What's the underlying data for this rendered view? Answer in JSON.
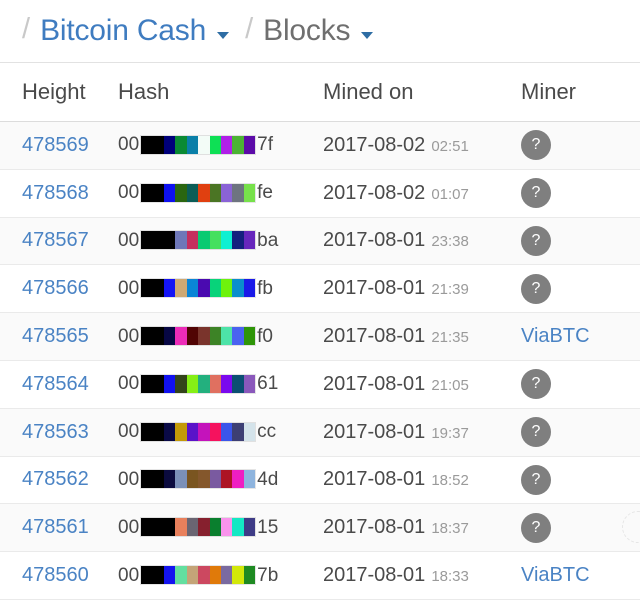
{
  "breadcrumb": {
    "separator": "/",
    "items": [
      {
        "label": "Bitcoin Cash",
        "style": "link",
        "caret": true
      },
      {
        "label": "Blocks",
        "style": "plain",
        "caret": true
      }
    ]
  },
  "table": {
    "columns": [
      "Height",
      "Hash",
      "Mined on",
      "Miner"
    ],
    "hash_prefix": "00",
    "rows": [
      {
        "height": "478569",
        "hash_prefix": "00",
        "hash_suffix": "7f",
        "hash_colors": [
          "#000000",
          "#000000",
          "#00007a",
          "#0a8a33",
          "#0a7fa8",
          "#f3fcf7",
          "#0ee055",
          "#b020e8",
          "#4cb334",
          "#5c0ba8"
        ],
        "mined_date": "2017-08-02",
        "mined_time": "02:51",
        "miner": "?",
        "miner_type": "unknown"
      },
      {
        "height": "478568",
        "hash_prefix": "00",
        "hash_suffix": "fe",
        "hash_colors": [
          "#000000",
          "#000000",
          "#0e11ef",
          "#2a6610",
          "#0b5d57",
          "#e04010",
          "#4b7524",
          "#8a63d6",
          "#6e7480",
          "#77e14b"
        ],
        "mined_date": "2017-08-02",
        "mined_time": "01:07",
        "miner": "?",
        "miner_type": "unknown"
      },
      {
        "height": "478567",
        "hash_prefix": "00",
        "hash_suffix": "ba",
        "hash_colors": [
          "#000000",
          "#000000",
          "#000000",
          "#6e77b8",
          "#c42f5e",
          "#09ca72",
          "#44e05f",
          "#0ef0d2",
          "#14217e",
          "#6727bc"
        ],
        "mined_date": "2017-08-01",
        "mined_time": "23:38",
        "miner": "?",
        "miner_type": "unknown"
      },
      {
        "height": "478566",
        "hash_prefix": "00",
        "hash_suffix": "fb",
        "hash_colors": [
          "#000000",
          "#000000",
          "#1414f5",
          "#cfa974",
          "#0a85d6",
          "#4a0ab0",
          "#08d37a",
          "#6ef20c",
          "#0a8fcc",
          "#1a1ae8"
        ],
        "mined_date": "2017-08-01",
        "mined_time": "21:39",
        "miner": "?",
        "miner_type": "unknown"
      },
      {
        "height": "478565",
        "hash_prefix": "00",
        "hash_suffix": "f0",
        "hash_colors": [
          "#000000",
          "#000000",
          "#070743",
          "#ec2cb8",
          "#510404",
          "#7a342c",
          "#3d8326",
          "#4de3a8",
          "#4a62f0",
          "#2e9508"
        ],
        "mined_date": "2017-08-01",
        "mined_time": "21:35",
        "miner": "ViaBTC",
        "miner_type": "named"
      },
      {
        "height": "478564",
        "hash_prefix": "00",
        "hash_suffix": "61",
        "hash_colors": [
          "#000000",
          "#000000",
          "#1111ef",
          "#33441a",
          "#86ef16",
          "#23b07e",
          "#e07060",
          "#7a09ee",
          "#0b4f72",
          "#8a58bb"
        ],
        "mined_date": "2017-08-01",
        "mined_time": "21:05",
        "miner": "?",
        "miner_type": "unknown"
      },
      {
        "height": "478563",
        "hash_prefix": "00",
        "hash_suffix": "cc",
        "hash_colors": [
          "#000000",
          "#000000",
          "#0a0a46",
          "#c49a08",
          "#5a13c9",
          "#c413bb",
          "#f5125e",
          "#3a55ea",
          "#3d3f74",
          "#d4e3ea"
        ],
        "mined_date": "2017-08-01",
        "mined_time": "19:37",
        "miner": "?",
        "miner_type": "unknown"
      },
      {
        "height": "478562",
        "hash_prefix": "00",
        "hash_suffix": "4d",
        "hash_colors": [
          "#000000",
          "#000000",
          "#0b0b3e",
          "#7b90b8",
          "#7a5520",
          "#84572c",
          "#7a5aa0",
          "#ad1424",
          "#ef1ec2",
          "#8eb4de"
        ],
        "mined_date": "2017-08-01",
        "mined_time": "18:52",
        "miner": "?",
        "miner_type": "unknown"
      },
      {
        "height": "478561",
        "hash_prefix": "00",
        "hash_suffix": "15",
        "hash_colors": [
          "#000000",
          "#000000",
          "#000000",
          "#e8805c",
          "#6a6572",
          "#86202e",
          "#0a7f2e",
          "#f994ec",
          "#14e8c4",
          "#3e3b86"
        ],
        "mined_date": "2017-08-01",
        "mined_time": "18:37",
        "miner": "?",
        "miner_type": "unknown",
        "edge_avatar": true
      },
      {
        "height": "478560",
        "hash_prefix": "00",
        "hash_suffix": "7b",
        "hash_colors": [
          "#000000",
          "#000000",
          "#1414ef",
          "#63dfa0",
          "#c4a478",
          "#cc4860",
          "#e07a0a",
          "#7a6aa0",
          "#d2e80a",
          "#1e8a22"
        ],
        "mined_date": "2017-08-01",
        "mined_time": "18:33",
        "miner": "ViaBTC",
        "miner_type": "named"
      }
    ]
  },
  "colors": {
    "link": "#4a83c4",
    "text": "#4a4a4a",
    "muted": "#9a9a9a",
    "row_alt": "#fafafa",
    "border": "#eaeaea",
    "unknown_badge": "#7f7f7f"
  }
}
